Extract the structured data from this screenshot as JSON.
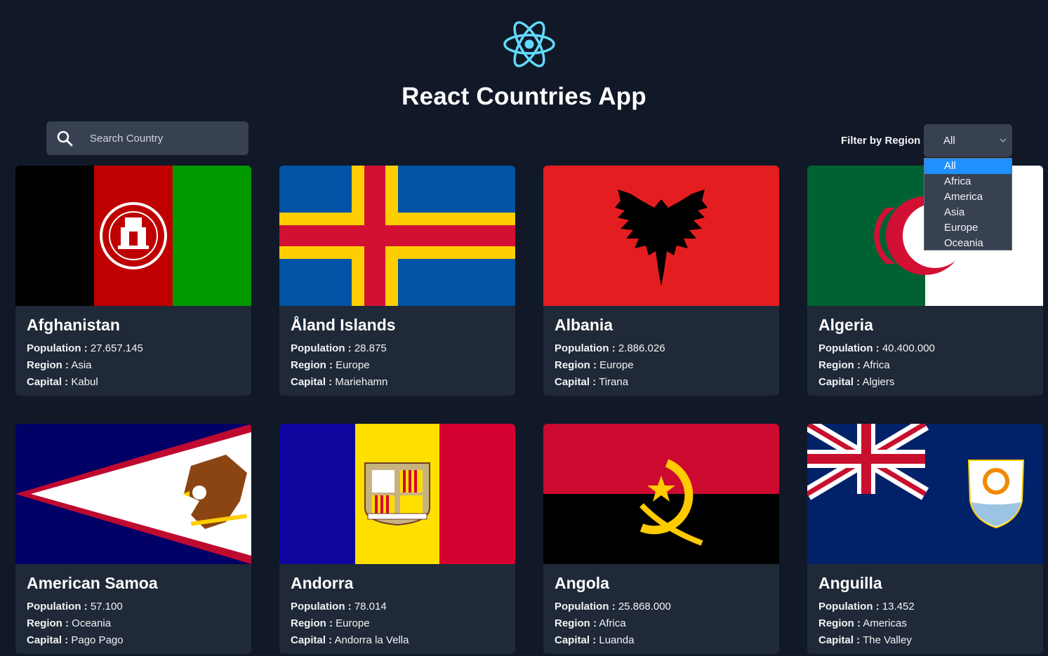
{
  "app": {
    "title": "React Countries App",
    "logo_icon": "react-atom-icon",
    "accent_color": "#61dafb"
  },
  "search": {
    "placeholder": "Search Country",
    "value": "",
    "icon": "search-icon"
  },
  "filter": {
    "label": "Filter by Region",
    "selected": "All",
    "options": [
      "All",
      "Africa",
      "America",
      "Asia",
      "Europe",
      "Oceania"
    ],
    "highlighted_color": "#1e90ff"
  },
  "field_labels": {
    "population": "Population :",
    "region": "Region :",
    "capital": "Capital :"
  },
  "countries": [
    {
      "name": "Afghanistan",
      "population": "27.657.145",
      "region": "Asia",
      "capital": "Kabul",
      "flag": "flag-afghanistan"
    },
    {
      "name": "Åland Islands",
      "population": "28.875",
      "region": "Europe",
      "capital": "Mariehamn",
      "flag": "flag-aland-islands"
    },
    {
      "name": "Albania",
      "population": "2.886.026",
      "region": "Europe",
      "capital": "Tirana",
      "flag": "flag-albania"
    },
    {
      "name": "Algeria",
      "population": "40.400.000",
      "region": "Africa",
      "capital": "Algiers",
      "flag": "flag-algeria"
    },
    {
      "name": "American Samoa",
      "population": "57.100",
      "region": "Oceania",
      "capital": "Pago Pago",
      "flag": "flag-american-samoa"
    },
    {
      "name": "Andorra",
      "population": "78.014",
      "region": "Europe",
      "capital": "Andorra la Vella",
      "flag": "flag-andorra"
    },
    {
      "name": "Angola",
      "population": "25.868.000",
      "region": "Africa",
      "capital": "Luanda",
      "flag": "flag-angola"
    },
    {
      "name": "Anguilla",
      "population": "13.452",
      "region": "Americas",
      "capital": "The Valley",
      "flag": "flag-anguilla"
    }
  ]
}
